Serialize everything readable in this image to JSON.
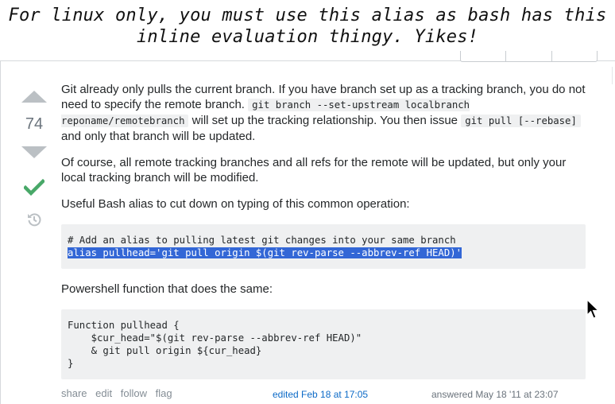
{
  "caption": {
    "line1": "For linux only, you must use this alias as bash has this",
    "line2": "inline evaluation thingy. Yikes!"
  },
  "vote": {
    "count": "74",
    "up_icon": "vote-up-arrow-icon",
    "down_icon": "vote-down-arrow-icon",
    "accepted_icon": "checkmark-icon",
    "history_icon": "history-icon",
    "accepted_color": "#48a868",
    "arrow_color": "#bbc0c4"
  },
  "answer": {
    "p1_a": "Git already only pulls the current branch. If you have branch set up as a tracking branch, you do not need to specify the remote branch. ",
    "p1_code1": "git branch --set-upstream localbranch reponame/remotebranch",
    "p1_b": " will set up the tracking relationship. You then issue ",
    "p1_code2": "git pull [--rebase]",
    "p1_c": " and only that branch will be updated.",
    "p2": "Of course, all remote tracking branches and all refs for the remote will be updated, but only your local tracking branch will be modified.",
    "p3": "Useful Bash alias to cut down on typing of this common operation:",
    "code1_comment": "# Add an alias to pulling latest git changes into your same branch",
    "code1_selected": "alias pullhead='git pull origin $(git rev-parse --abbrev-ref HEAD)'",
    "p4": "Powershell function that does the same:",
    "code2": "Function pullhead {\n    $cur_head=\"$(git rev-parse --abbrev-ref HEAD)\"\n    & git pull origin ${cur_head}\n}"
  },
  "menu": {
    "share": "share",
    "edit": "edit",
    "follow": "follow",
    "flag": "flag"
  },
  "meta": {
    "edited": "edited Feb 18 at 17:05",
    "answered": "answered May 18 '11 at 23:07"
  },
  "colors": {
    "selection": "#3367d6",
    "link": "#0c6ac7",
    "code_bg": "#eff0f1"
  }
}
